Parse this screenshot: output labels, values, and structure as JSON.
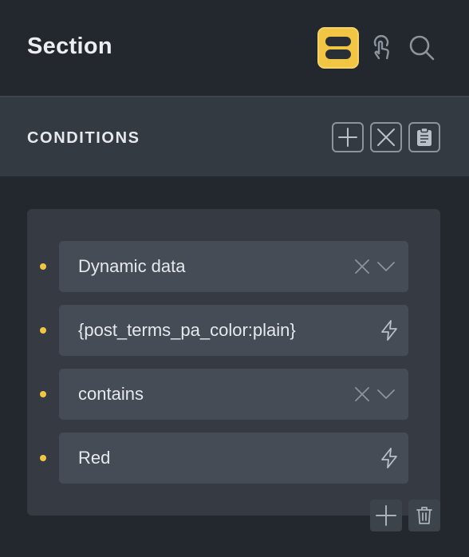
{
  "header": {
    "title": "Section",
    "icons": {
      "active": "stacked-layout-icon",
      "pointer": "pointer-hand-icon",
      "search": "search-icon"
    }
  },
  "conditions": {
    "title": "CONDITIONS",
    "actions": {
      "add": "plus-icon",
      "clear": "x-icon",
      "paste": "clipboard-icon"
    }
  },
  "group": {
    "rows": [
      {
        "value": "Dynamic data",
        "controls": [
          "clear",
          "dropdown"
        ]
      },
      {
        "value": "{post_terms_pa_color:plain}",
        "controls": [
          "dynamic-data"
        ]
      },
      {
        "value": "contains",
        "controls": [
          "clear",
          "dropdown"
        ]
      },
      {
        "value": "Red",
        "controls": [
          "dynamic-data"
        ]
      }
    ],
    "footer": {
      "add": "plus-icon",
      "delete": "trash-icon"
    }
  },
  "colors": {
    "accent": "#f1c644",
    "background": "#23272e",
    "panel": "#343a42",
    "field": "#454c55"
  }
}
